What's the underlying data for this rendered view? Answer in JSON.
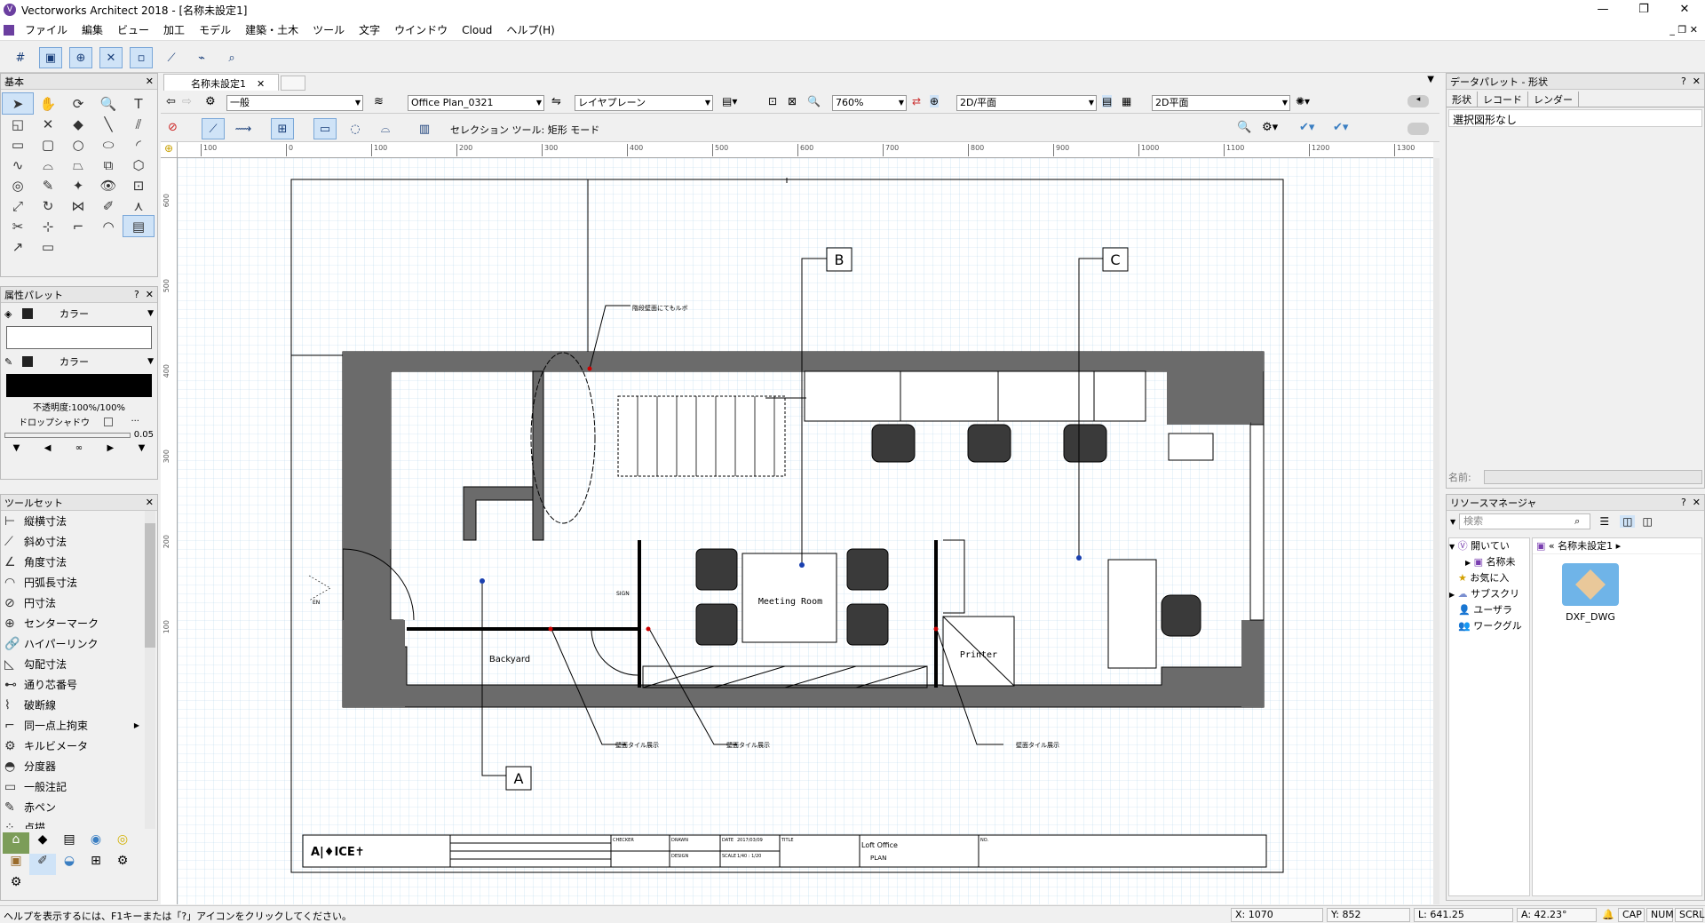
{
  "window": {
    "title": "Vectorworks Architect 2018 - [名称未設定1]"
  },
  "menu": [
    "ファイル",
    "編集",
    "ビュー",
    "加工",
    "モデル",
    "建築・土木",
    "ツール",
    "文字",
    "ウインドウ",
    "Cloud",
    "ヘルプ(H)"
  ],
  "palettes": {
    "basic": {
      "title": "基本"
    },
    "attributes": {
      "title": "属性パレット",
      "fill_label": "カラー",
      "pen_label": "カラー",
      "opacity": "不透明度:100%/100%",
      "shadow": "ドロップシャドウ",
      "line_weight": "0.05"
    },
    "toolset": {
      "title": "ツールセット",
      "items": [
        "縦横寸法",
        "斜め寸法",
        "角度寸法",
        "円弧長寸法",
        "円寸法",
        "センターマーク",
        "ハイパーリンク",
        "勾配寸法",
        "通り芯番号",
        "破断線",
        "同一点上拘束",
        "キルビメータ",
        "分度器",
        "一般注記",
        "赤ペン",
        "点描"
      ]
    }
  },
  "document": {
    "tab": "名称未設定1"
  },
  "viewbar": {
    "class": "一般",
    "layer": "Office Plan_0321",
    "layer_plane": "レイヤプレーン",
    "zoom": "760%",
    "view": "2D/平面",
    "render": "2D平面"
  },
  "modebar": {
    "status": "セレクション ツール: 矩形 モード"
  },
  "ruler": {
    "h_ticks": [
      "100",
      "0",
      "100",
      "200",
      "300",
      "400",
      "500",
      "600",
      "700",
      "800",
      "900",
      "1000",
      "1100",
      "1200",
      "1300"
    ],
    "v_ticks": [
      "600",
      "500",
      "400",
      "300",
      "200",
      "100"
    ]
  },
  "drawing": {
    "markers": [
      "A",
      "B",
      "C"
    ],
    "rooms": [
      "Meeting Room",
      "Backyard",
      "Printer"
    ],
    "notes": [
      "階段壁面にてもルボ",
      "壁面タイル展示",
      "壁面タイル展示",
      "壁面タイル展示"
    ],
    "small_labels": [
      "SIGN",
      "EN"
    ],
    "titleblock": {
      "logo": "A|♦ICE✝",
      "project": "Loft Office",
      "sheet": "PLAN",
      "labels": [
        "CHECKER",
        "DRAWN",
        "DESIGN",
        "DATE",
        "SCALE",
        "TITLE",
        "NO."
      ],
      "date": "2017/03/09",
      "scale": "1/40 : 1/20"
    }
  },
  "data_palette": {
    "title": "データパレット - 形状",
    "tabs": [
      "形状",
      "レコード",
      "レンダー"
    ],
    "content": "選択図形なし",
    "name_label": "名前:"
  },
  "resource_manager": {
    "title": "リソースマネージャ",
    "search_placeholder": "検索",
    "tree": [
      "開いてい",
      "名称未",
      "お気に入",
      "サブスクリ",
      "ユーザラ",
      "ワークグル"
    ],
    "breadcrumb": "名称未設定1",
    "folder": "DXF_DWG"
  },
  "status": {
    "help": "ヘルプを表示するには、F1キーまたは「?」アイコンをクリックしてください。",
    "x": "X: 1070",
    "y": "Y: 852",
    "l": "L: 641.25",
    "a": "A: 42.23°",
    "caps": "CAP",
    "num": "NUM",
    "scrl": "SCRL"
  }
}
